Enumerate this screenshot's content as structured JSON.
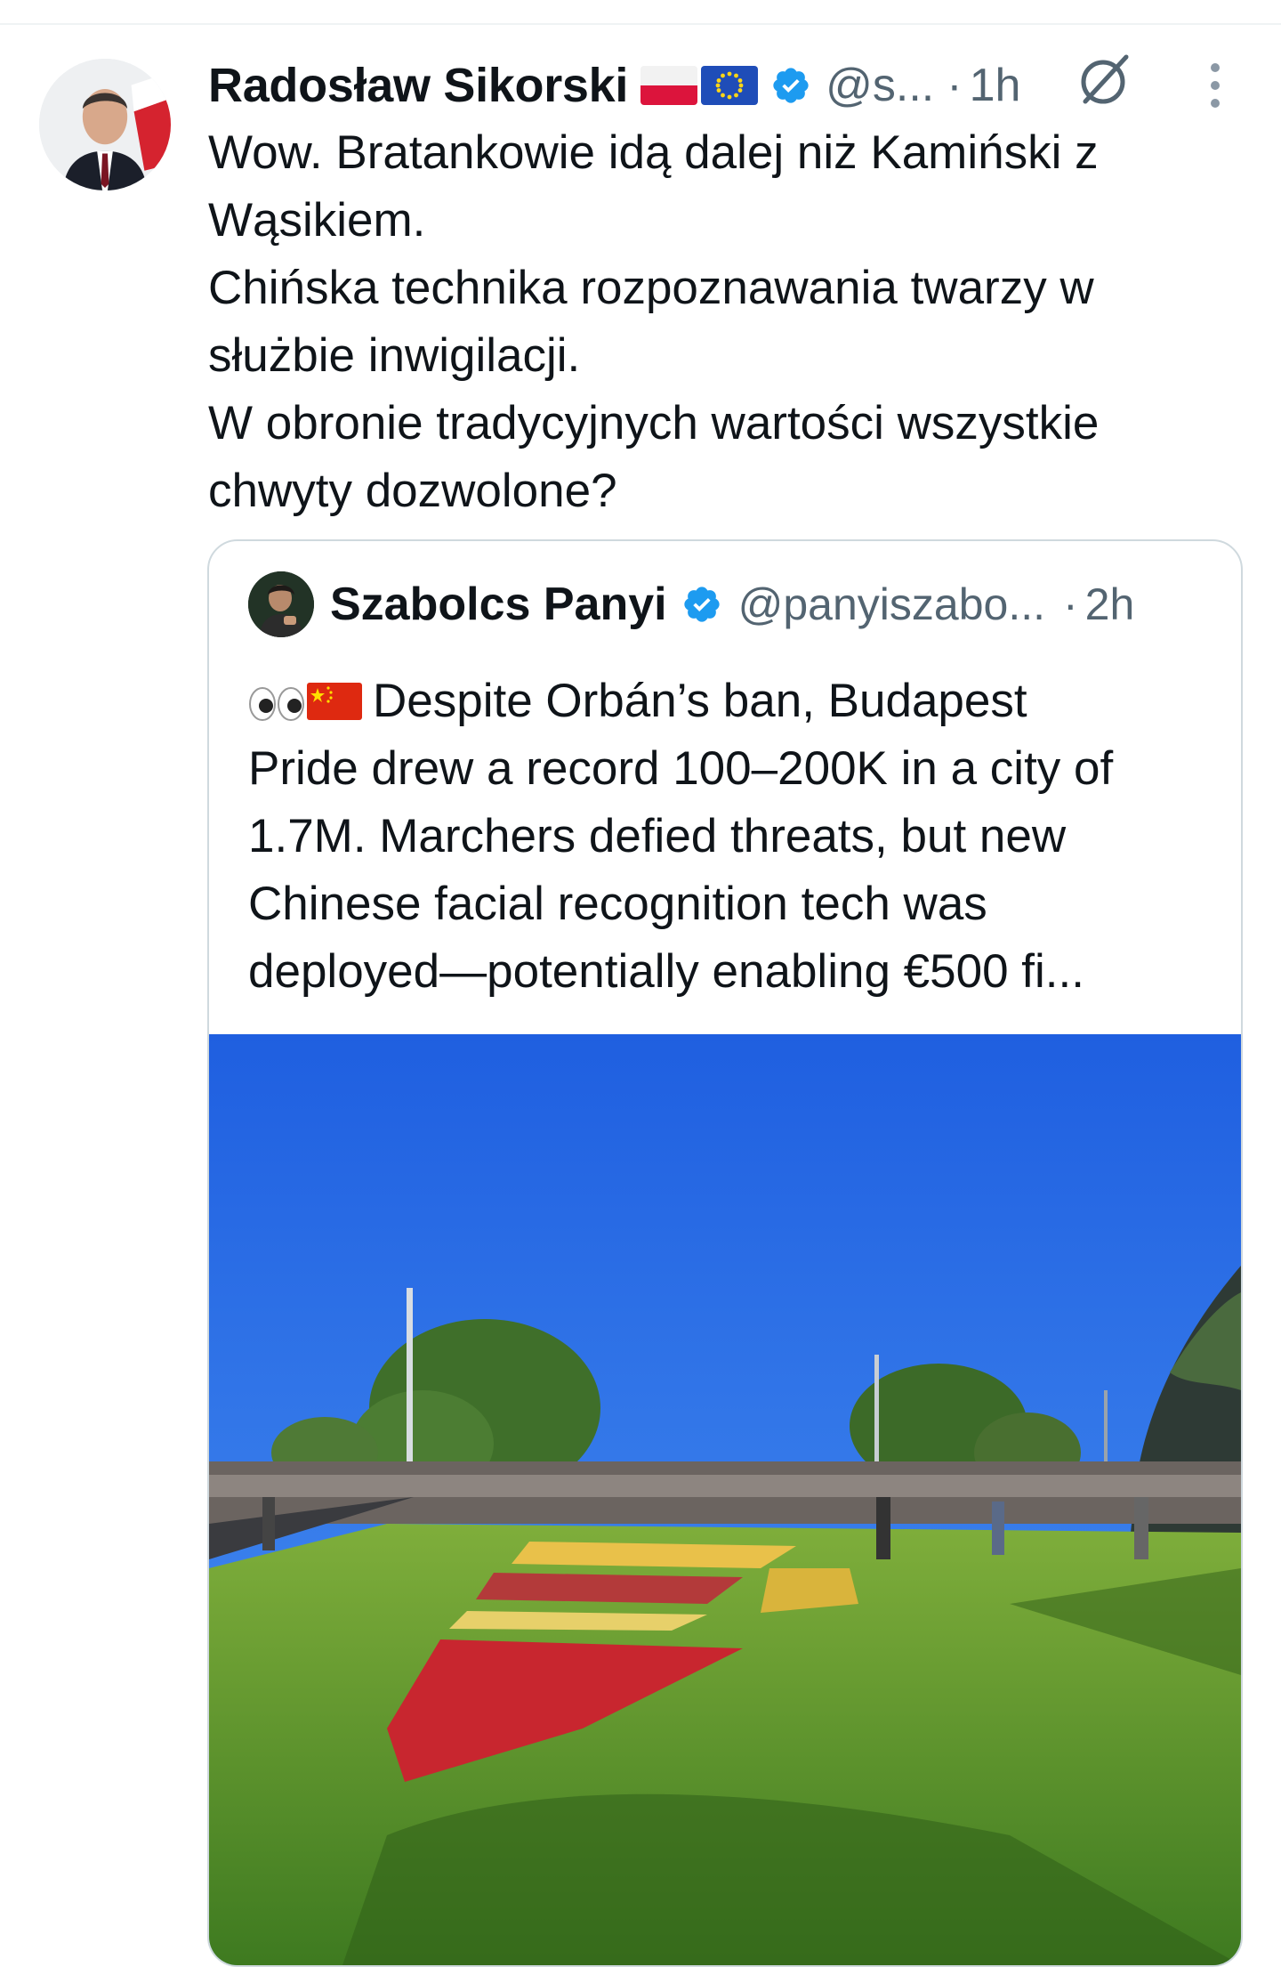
{
  "post": {
    "author_name": "Radosław Sikorski",
    "handle": "@s...",
    "separator": "·",
    "time": "1h",
    "text_lines": [
      "Wow. Bratankowie idą dalej niż Kamiński z",
      "Wąsikiem.",
      "Chińska technika rozpoznawania twarzy w",
      "służbie inwigilacji.",
      "W obronie tradycyjnych wartości wszystkie",
      "chwyty dozwolone?"
    ]
  },
  "quoted_post": {
    "author_name": "Szabolcs Panyi",
    "handle": "@panyiszabo...",
    "separator": "·",
    "time": "2h",
    "text_first": "Despite Orbán’s ban, Budapest",
    "text_lines": [
      "Pride drew a record 100–200K in a city of",
      "1.7M. Marchers defied threats, but new",
      "Chinese facial recognition tech was",
      "deployed—potentially enabling €500 fi..."
    ]
  },
  "icons": {
    "verified": "verified-badge-icon",
    "grok": "grok-icon",
    "more": "more-options-icon",
    "flags": [
      "poland-flag",
      "eu-flag"
    ]
  },
  "colors": {
    "verified": "#1d9bf0",
    "secondary_text": "#536471",
    "border": "#cfd9de"
  }
}
